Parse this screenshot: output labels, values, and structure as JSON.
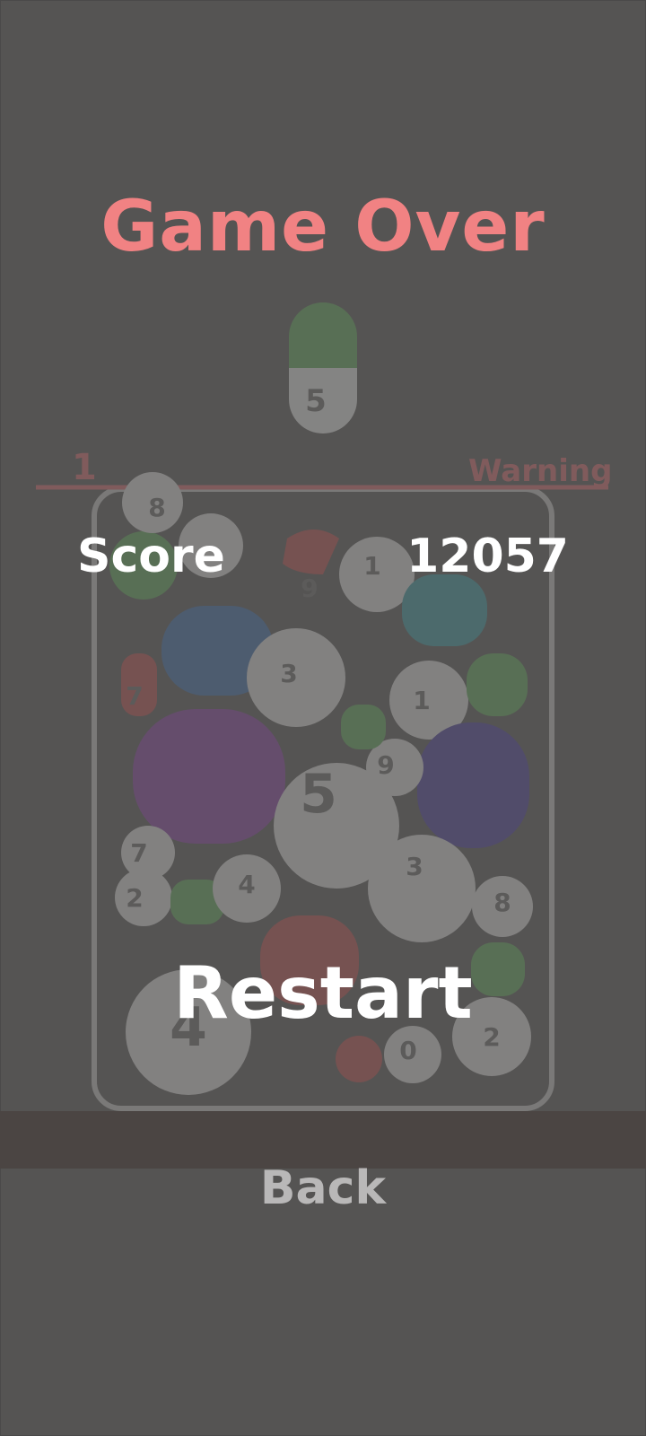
{
  "game_over": {
    "title": "Game Over",
    "score_label": "Score",
    "score_value": "12057",
    "restart_label": "Restart",
    "back_label": "Back"
  },
  "background_board": {
    "level_number": "1",
    "warning_label": "Warning",
    "next_pill_number": "5",
    "pill_numbers": [
      "8",
      "1",
      "9",
      "3",
      "7",
      "1",
      "5",
      "9",
      "3",
      "8",
      "4",
      "7",
      "2",
      "4",
      "0",
      "2",
      "5"
    ]
  },
  "colors": {
    "title": "#f18283",
    "background": "#555453",
    "text": "#ffffff",
    "back_text": "#b9b8b8",
    "bar": "#4b4543"
  }
}
